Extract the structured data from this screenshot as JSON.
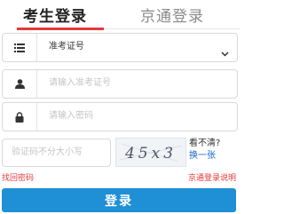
{
  "tabs": [
    {
      "label": "考生登录",
      "active": true
    },
    {
      "label": "京通登录",
      "active": false
    }
  ],
  "id_type": {
    "selected": "准考证号",
    "icon": "list-icon"
  },
  "ticket_field": {
    "placeholder": "请输入准考证号",
    "icon": "user-icon"
  },
  "password_field": {
    "placeholder": "请输入密码",
    "icon": "lock-icon"
  },
  "captcha": {
    "placeholder": "验证码不分大小写",
    "image_text": "45x3",
    "cant_see": "看不清?",
    "change": "换一张"
  },
  "links": {
    "forgot": "找回密码",
    "help": "京通登录说明"
  },
  "login_button": "登录",
  "colors": {
    "accent": "#e4393c",
    "button": "#1f8fd6",
    "link": "#1a66c9"
  }
}
